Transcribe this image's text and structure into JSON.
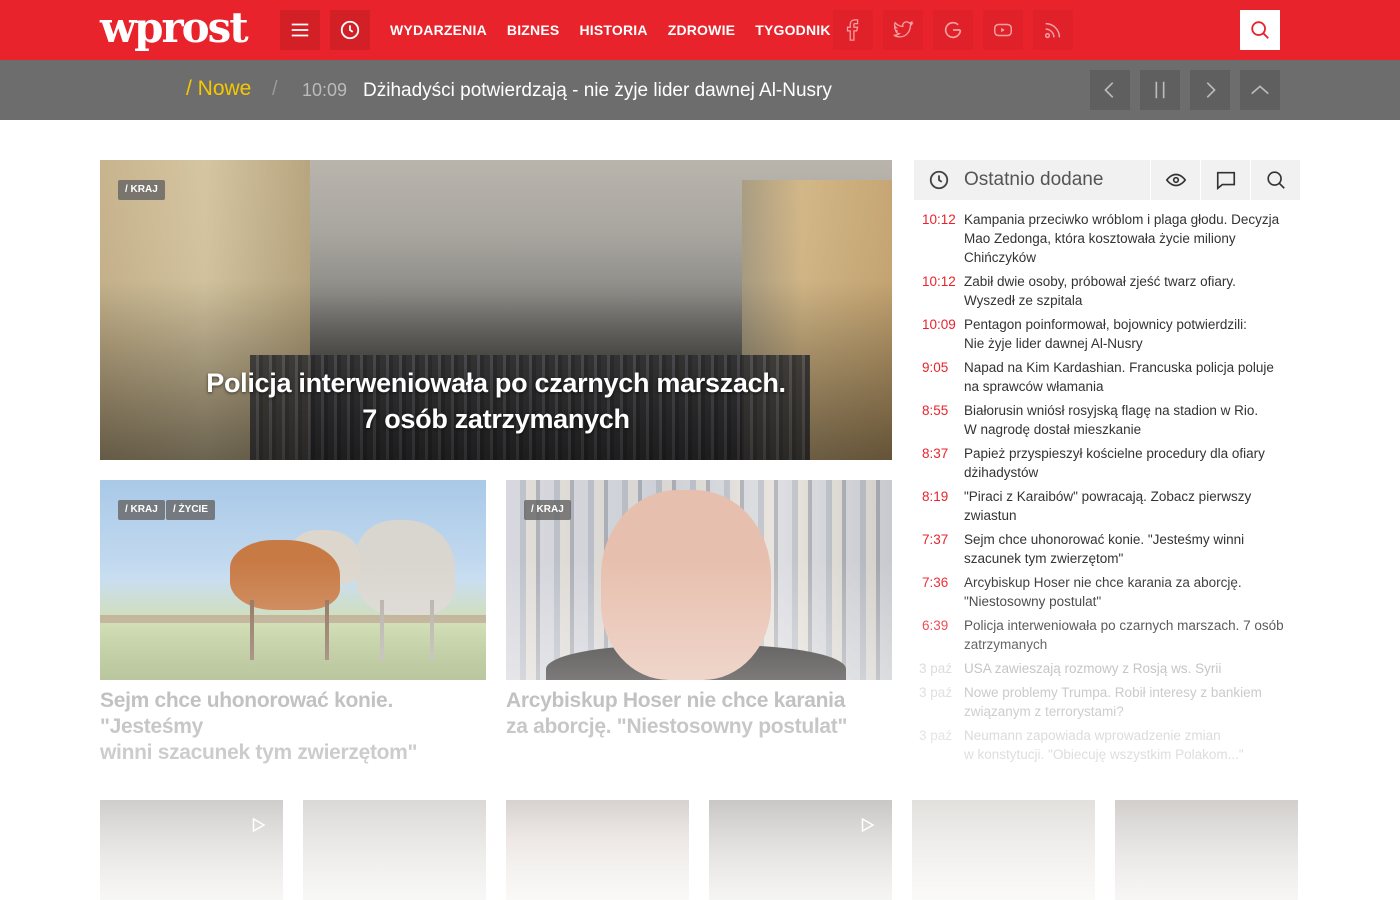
{
  "header": {
    "logo": "wprost",
    "nav": [
      "WYDARZENIA",
      "BIZNES",
      "HISTORIA",
      "ZDROWIE",
      "TYGODNIK"
    ],
    "social_icons": [
      "facebook-icon",
      "twitter-icon",
      "google-icon",
      "youtube-icon",
      "rss-icon"
    ],
    "brand_color": "#e8232b"
  },
  "ticker": {
    "label": "/ Nowe",
    "separator": "/",
    "time": "10:09",
    "text": "Dżihadyści potwierdzają - nie żyje lider dawnej Al-Nusry"
  },
  "hero": {
    "tag": "/ KRAJ",
    "title_line1": "Policja interweniowała po czarnych marszach.",
    "title_line2": "7 osób zatrzymanych"
  },
  "cards": [
    {
      "tags": [
        "/ KRAJ",
        "/ ŻYCIE"
      ],
      "title_line1": "Sejm chce uhonorować konie. \"Jesteśmy",
      "title_line2": "winni szacunek tym zwierzętom\""
    },
    {
      "tags": [
        "/ KRAJ"
      ],
      "title_line1": "Arcybiskup Hoser nie chce karania",
      "title_line2": "za aborcję. \"Niestosowny postulat\""
    }
  ],
  "sidebar": {
    "title": "Ostatnio dodane",
    "items": [
      {
        "time": "10:12",
        "line1": "Kampania przeciwko wróblom i plaga głodu. Decyzja",
        "line2": "Mao Zedonga, która kosztowała życie miliony",
        "line3": "Chińczyków"
      },
      {
        "time": "10:12",
        "line1": "Zabił dwie osoby, próbował zjeść twarz ofiary.",
        "line2": "Wyszedł ze szpitala"
      },
      {
        "time": "10:09",
        "line1": "Pentagon poinformował, bojownicy potwierdzili:",
        "line2": "Nie żyje lider dawnej Al-Nusry"
      },
      {
        "time": "9:05",
        "line1": "Napad na Kim Kardashian. Francuska policja poluje",
        "line2": "na sprawców włamania"
      },
      {
        "time": "8:55",
        "line1": "Białorusin wniósł rosyjską flagę na stadion w Rio.",
        "line2": "W nagrodę dostał mieszkanie"
      },
      {
        "time": "8:37",
        "line1": "Papież przyspieszył kościelne procedury dla ofiary",
        "line2": "dżihadystów"
      },
      {
        "time": "8:19",
        "line1": "\"Piraci z Karaibów\" powracają. Zobacz pierwszy",
        "line2": "zwiastun"
      },
      {
        "time": "7:37",
        "line1": "Sejm chce uhonorować konie. \"Jesteśmy winni",
        "line2": "szacunek tym zwierzętom\""
      },
      {
        "time": "7:36",
        "line1": "Arcybiskup Hoser nie chce karania za aborcję.",
        "line2": "\"Niestosowny postulat\""
      },
      {
        "time": "6:39",
        "line1": "Policja interweniowała po czarnych marszach. 7 osób",
        "line2": "zatrzymanych"
      },
      {
        "time": "3 paź",
        "line1": "USA zawieszają rozmowy z Rosją ws. Syrii"
      },
      {
        "time": "3 paź",
        "line1": "Nowe problemy Trumpa. Robił interesy z bankiem",
        "line2": "związanym z terrorystami?"
      },
      {
        "time": "3 paź",
        "line1": "Neumann zapowiada wprowadzenie zmian",
        "line2": "w konstytucji. \"Obiecuję wszystkim Polakom...\""
      }
    ]
  }
}
